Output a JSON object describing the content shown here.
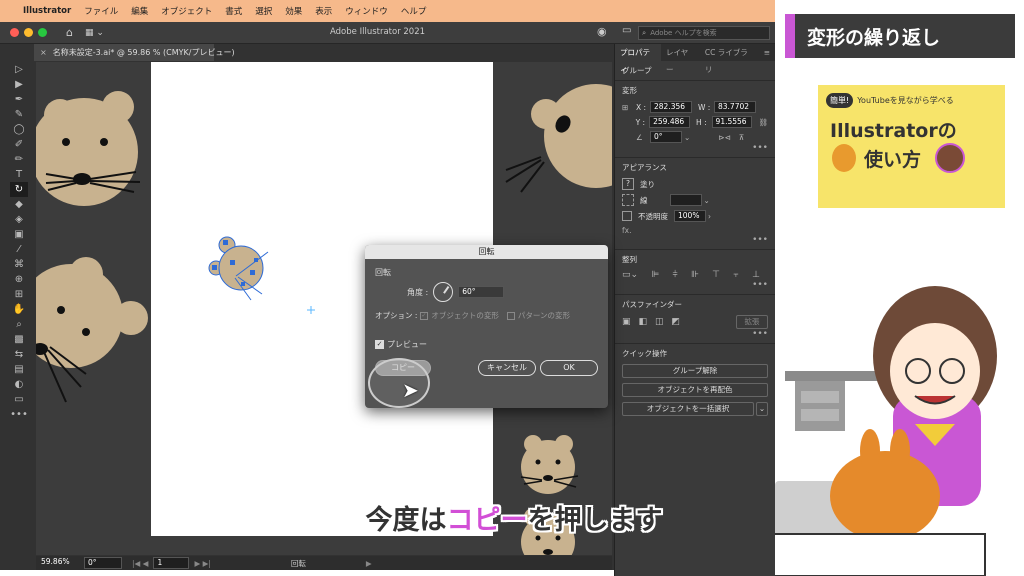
{
  "menubar": {
    "apple": "",
    "app_name": "Illustrator",
    "items": [
      "ファイル",
      "編集",
      "オブジェクト",
      "書式",
      "選択",
      "効果",
      "表示",
      "ウィンドウ",
      "ヘルプ"
    ]
  },
  "window": {
    "title": "Adobe Illustrator 2021",
    "search_placeholder": "Adobe ヘルプを検索"
  },
  "document_tab": {
    "label": "名称未設定-3.ai* @ 59.86 % (CMYK/プレビュー)"
  },
  "status_bar": {
    "zoom": "59.86%",
    "rotation": "0°",
    "artboard_number": "1",
    "tool_name": "回転"
  },
  "panel": {
    "tabs": [
      "プロパティ",
      "レイヤー",
      "CC ライブラリ"
    ],
    "selection_type": "グループ",
    "transform": {
      "title": "変形",
      "x_label": "X :",
      "x_value": "282.356",
      "y_label": "Y :",
      "y_value": "259.486",
      "w_label": "W :",
      "w_value": "83.7702",
      "h_label": "H :",
      "h_value": "91.5556",
      "angle_value": "0°"
    },
    "appearance": {
      "title": "アピアランス",
      "fill_label": "塗り",
      "stroke_label": "線",
      "opacity_label": "不透明度",
      "opacity_value": "100%",
      "fx_label": "fx."
    },
    "align": {
      "title": "整列"
    },
    "pathfinder": {
      "title": "パスファインダー",
      "expand_label": "拡張"
    },
    "quick_actions": {
      "title": "クイック操作",
      "buttons": [
        "グループ解除",
        "オブジェクトを再配色",
        "オブジェクトを一括選択"
      ]
    }
  },
  "dialog": {
    "title": "回転",
    "section_label": "回転",
    "angle_label": "角度 :",
    "angle_value": "60°",
    "options_label": "オプション :",
    "transform_objects_label": "オブジェクトの変形",
    "transform_patterns_label": "パターンの変形",
    "preview_label": "プレビュー",
    "copy_button": "コピー",
    "cancel_button": "キャンセル",
    "ok_button": "OK"
  },
  "overlay": {
    "banner_title": "変形の繰り返し",
    "card_badge": "簡単!",
    "card_tagline": "YouTubeを見ながら学べる",
    "card_title_line1": "Illustratorの",
    "card_title_line2": "使い方",
    "subtitle_before": "今度は",
    "subtitle_highlight": "コピー",
    "subtitle_after": "を押します"
  },
  "colors": {
    "menubar": "#f6b98b",
    "accent_purple": "#c957d4",
    "card_yellow": "#f7e46a",
    "mouse_tan": "#c8b28f",
    "selection_blue": "#2e6bd6"
  }
}
